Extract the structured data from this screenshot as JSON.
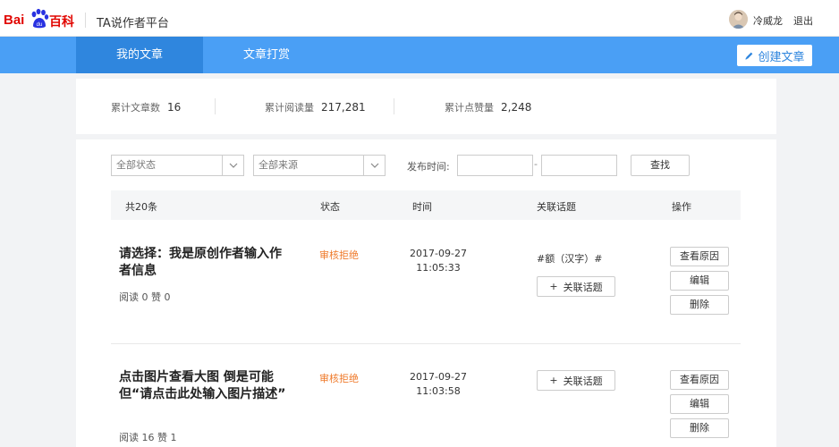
{
  "header": {
    "logo_bai": "Bai",
    "logo_baike": "百科",
    "platform_title": "TA说作者平台",
    "username": "冷威龙",
    "logout": "退出"
  },
  "nav": {
    "tabs": [
      {
        "label": "我的文章",
        "active": true
      },
      {
        "label": "文章打赏",
        "active": false
      }
    ],
    "create_label": "创建文章"
  },
  "stats": [
    {
      "label": "累计文章数",
      "value": "16"
    },
    {
      "label": "累计阅读量",
      "value": "217,281"
    },
    {
      "label": "累计点赞量",
      "value": "2,248"
    }
  ],
  "filters": {
    "status_selected": "全部状态",
    "source_selected": "全部来源",
    "date_label": "发布时间:",
    "date_separator": "-",
    "search_label": "查找"
  },
  "table": {
    "headers": [
      "共20条",
      "状态",
      "时间",
      "关联话题",
      "操作"
    ],
    "rows": [
      {
        "title": "请选择：我是原创作者输入作者信息",
        "meta": "阅读 0  赞 0",
        "status": "审核拒绝",
        "date": "2017-09-27",
        "clock": "11:05:33",
        "topic": "#额（汉字）#",
        "topic_button": "关联话题",
        "actions": [
          "查看原因",
          "编辑",
          "删除"
        ]
      },
      {
        "title": "点击图片查看大图 倒是可能但“请点击此处输入图片描述”",
        "meta": "阅读 16  赞 1",
        "status": "审核拒绝",
        "date": "2017-09-27",
        "clock": "11:03:58",
        "topic": "",
        "topic_button": "关联话题",
        "actions": [
          "查看原因",
          "编辑",
          "删除"
        ]
      }
    ]
  },
  "colors": {
    "nav_bg": "#4a9ff5",
    "nav_active": "#2f86de",
    "status_rejected": "#ef7a2b",
    "brand_red": "#e10601"
  }
}
